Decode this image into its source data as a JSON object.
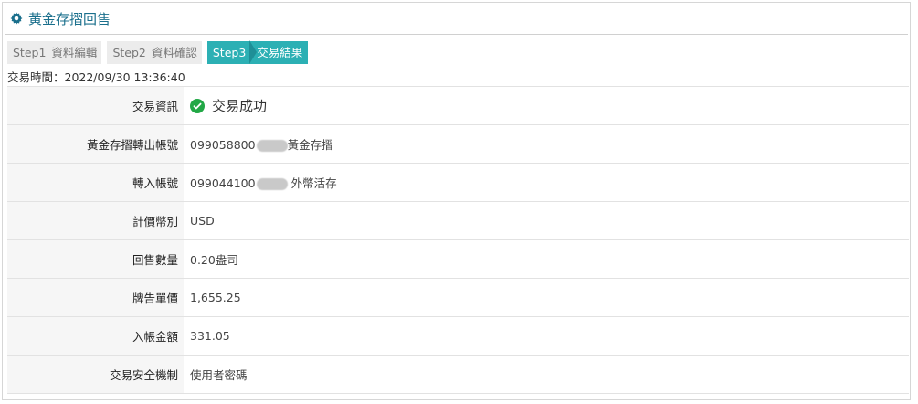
{
  "header": {
    "title": "黃金存摺回售",
    "icon": "gear-icon"
  },
  "steps": [
    {
      "num": "Step1",
      "label": "資料編輯",
      "active": false
    },
    {
      "num": "Step2",
      "label": "資料確認",
      "active": false
    },
    {
      "num": "Step3",
      "label": "交易結果",
      "active": true
    }
  ],
  "trade_time": "交易時間：2022/09/30 13:36:40",
  "rows": {
    "result": {
      "label": "交易資訊",
      "value": "交易成功"
    },
    "from_account": {
      "label": "黃金存摺轉出帳號",
      "prefix": "099058800",
      "suffix": "黃金存摺"
    },
    "to_account": {
      "label": "轉入帳號",
      "prefix": "099044100",
      "suffix": "外幣活存"
    },
    "currency": {
      "label": "計價幣別",
      "value": "USD"
    },
    "quantity": {
      "label": "回售數量",
      "value": "0.20盎司"
    },
    "price": {
      "label": "牌告單價",
      "value": "1,655.25"
    },
    "amount": {
      "label": "入帳金額",
      "value": "331.05"
    },
    "security": {
      "label": "交易安全機制",
      "value": "使用者密碼"
    }
  },
  "colors": {
    "title": "#1a6f8c",
    "step_active": "#2cb0b4",
    "success": "#22a846"
  }
}
